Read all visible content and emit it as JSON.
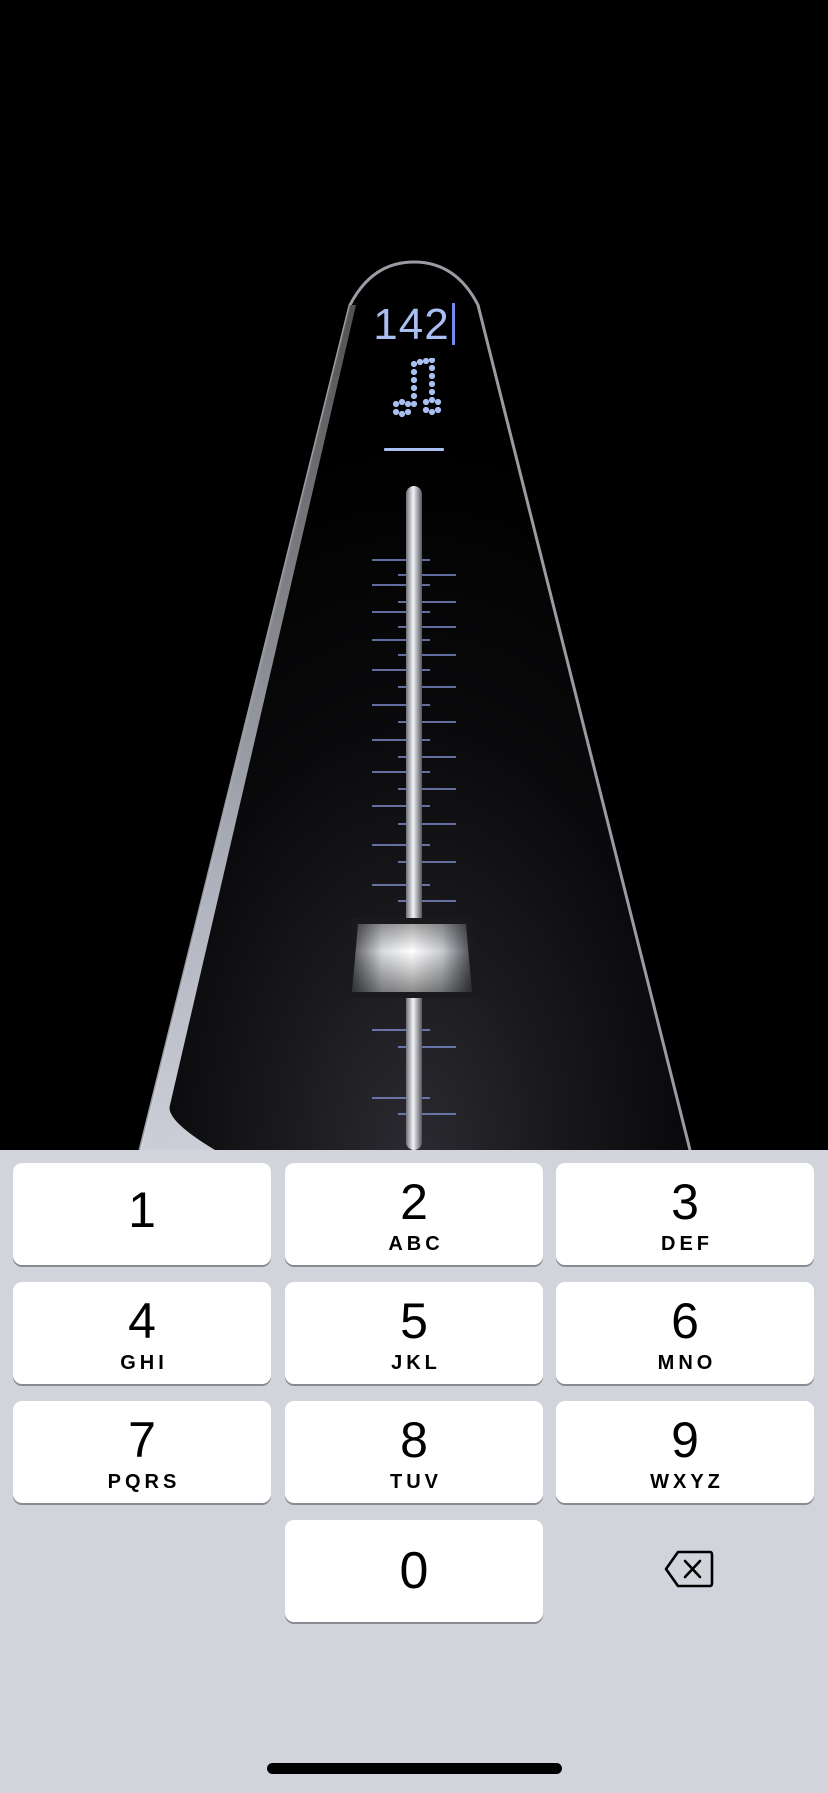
{
  "metronome": {
    "tempo": "142",
    "note_icon": "eighth-notes-icon",
    "accent_color": "#a9bff2",
    "scale_color": "#7f8fd0"
  },
  "keypad": {
    "keys": [
      {
        "digit": "1",
        "letters": ""
      },
      {
        "digit": "2",
        "letters": "ABC"
      },
      {
        "digit": "3",
        "letters": "DEF"
      },
      {
        "digit": "4",
        "letters": "GHI"
      },
      {
        "digit": "5",
        "letters": "JKL"
      },
      {
        "digit": "6",
        "letters": "MNO"
      },
      {
        "digit": "7",
        "letters": "PQRS"
      },
      {
        "digit": "8",
        "letters": "TUV"
      },
      {
        "digit": "9",
        "letters": "WXYZ"
      },
      {
        "digit": "0",
        "letters": ""
      }
    ],
    "backspace_icon": "backspace-icon",
    "background_color": "#d1d4db"
  }
}
